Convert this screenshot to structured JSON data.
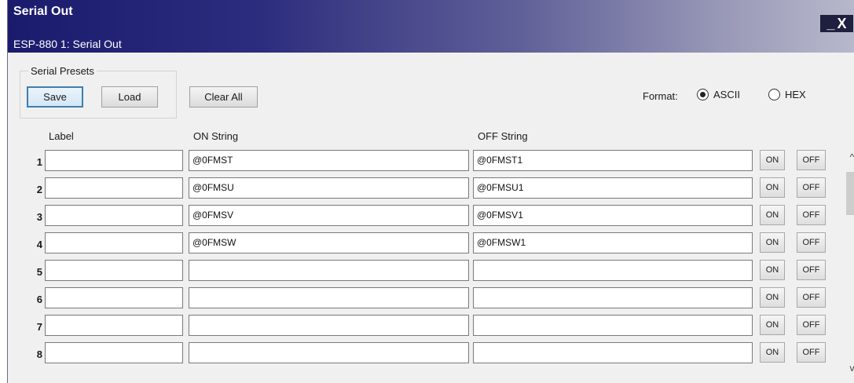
{
  "window": {
    "title": "Serial Out",
    "subtitle": "ESP-880 1: Serial Out",
    "minimize_glyph": "_",
    "close_glyph": "X"
  },
  "presets": {
    "legend": "Serial Presets",
    "save_label": "Save",
    "load_label": "Load"
  },
  "toolbar": {
    "clear_all_label": "Clear All"
  },
  "format": {
    "label": "Format:",
    "options": [
      "ASCII",
      "HEX"
    ],
    "selected": "ASCII"
  },
  "columns": {
    "label": "Label",
    "on_string": "ON String",
    "off_string": "OFF String"
  },
  "row_buttons": {
    "on_label": "ON",
    "off_label": "OFF"
  },
  "rows": [
    {
      "num": "1",
      "label": "",
      "on": "@0FMST",
      "off": "@0FMST1"
    },
    {
      "num": "2",
      "label": "",
      "on": "@0FMSU",
      "off": "@0FMSU1"
    },
    {
      "num": "3",
      "label": "",
      "on": "@0FMSV",
      "off": "@0FMSV1"
    },
    {
      "num": "4",
      "label": "",
      "on": "@0FMSW",
      "off": "@0FMSW1"
    },
    {
      "num": "5",
      "label": "",
      "on": "",
      "off": ""
    },
    {
      "num": "6",
      "label": "",
      "on": "",
      "off": ""
    },
    {
      "num": "7",
      "label": "",
      "on": "",
      "off": ""
    },
    {
      "num": "8",
      "label": "",
      "on": "",
      "off": ""
    }
  ],
  "scrollbar": {
    "up_icon": "chevron-up-icon",
    "down_icon": "chevron-down-icon"
  },
  "colors": {
    "title_gradient_start": "#1b1b6e",
    "title_gradient_end": "#b8b8cc",
    "focus_border": "#3c7fb1"
  }
}
